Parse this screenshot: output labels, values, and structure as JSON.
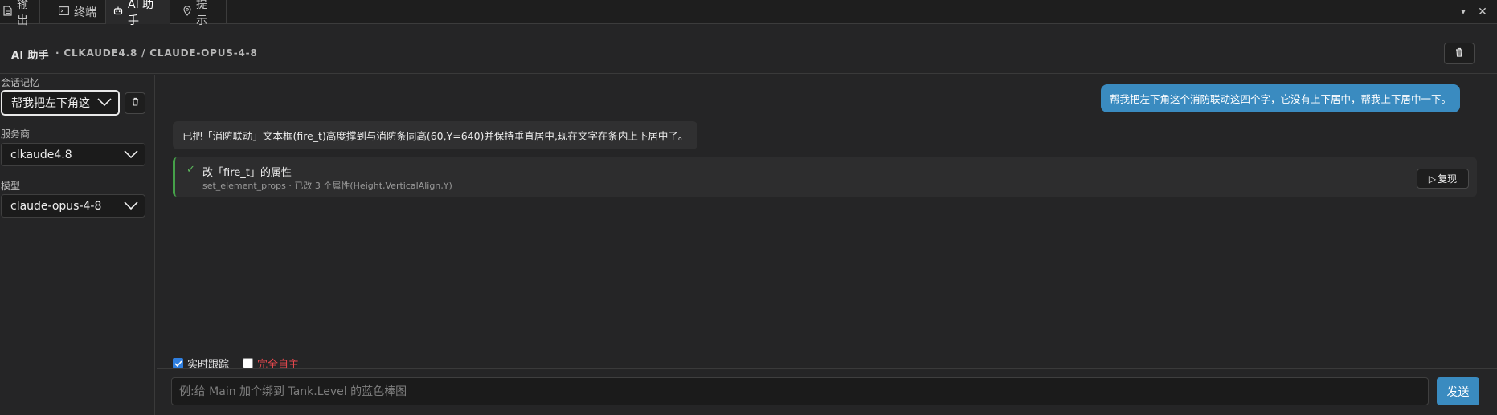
{
  "tabs": [
    {
      "label": "输出",
      "icon": "document-icon"
    },
    {
      "label": "终端",
      "icon": "terminal-icon"
    },
    {
      "label": "AI 助手",
      "icon": "robot-icon",
      "active": true
    },
    {
      "label": "提示",
      "icon": "pin-icon"
    }
  ],
  "window_controls": {
    "more": "▾",
    "close": "✕"
  },
  "header": {
    "title": "AI 助手",
    "subtitle": "· CLKAUDE4.8 / CLAUDE-OPUS-4-8"
  },
  "sidebar": {
    "session_label": "会话记忆",
    "session_value": "帮我把左下角这",
    "provider_label": "服务商",
    "provider_value": "clkaude4.8",
    "model_label": "模型",
    "model_value": "claude-opus-4-8"
  },
  "chat": {
    "user_message": "帮我把左下角这个消防联动这四个字，它没有上下居中，帮我上下居中一下。",
    "ai_message": "已把「消防联动」文本框(fire_t)高度撑到与消防条同高(60,Y=640)并保持垂直居中,现在文字在条内上下居中了。",
    "tool": {
      "check": "✓",
      "title": "改「fire_t」的属性",
      "desc": "set_element_props · 已改 3 个属性(Height,VerticalAlign,Y)",
      "replay_label": "复现",
      "replay_icon": "▷"
    }
  },
  "options": {
    "realtime_label": "实时跟踪",
    "realtime_checked": true,
    "autonomous_label": "完全自主",
    "autonomous_checked": false,
    "autonomous_color": "#e5484d"
  },
  "composer": {
    "placeholder": "例:给 Main 加个绑到 Tank.Level 的蓝色棒图",
    "send_label": "发送"
  },
  "colors": {
    "accent": "#3a8bc0",
    "success": "#45a049"
  }
}
